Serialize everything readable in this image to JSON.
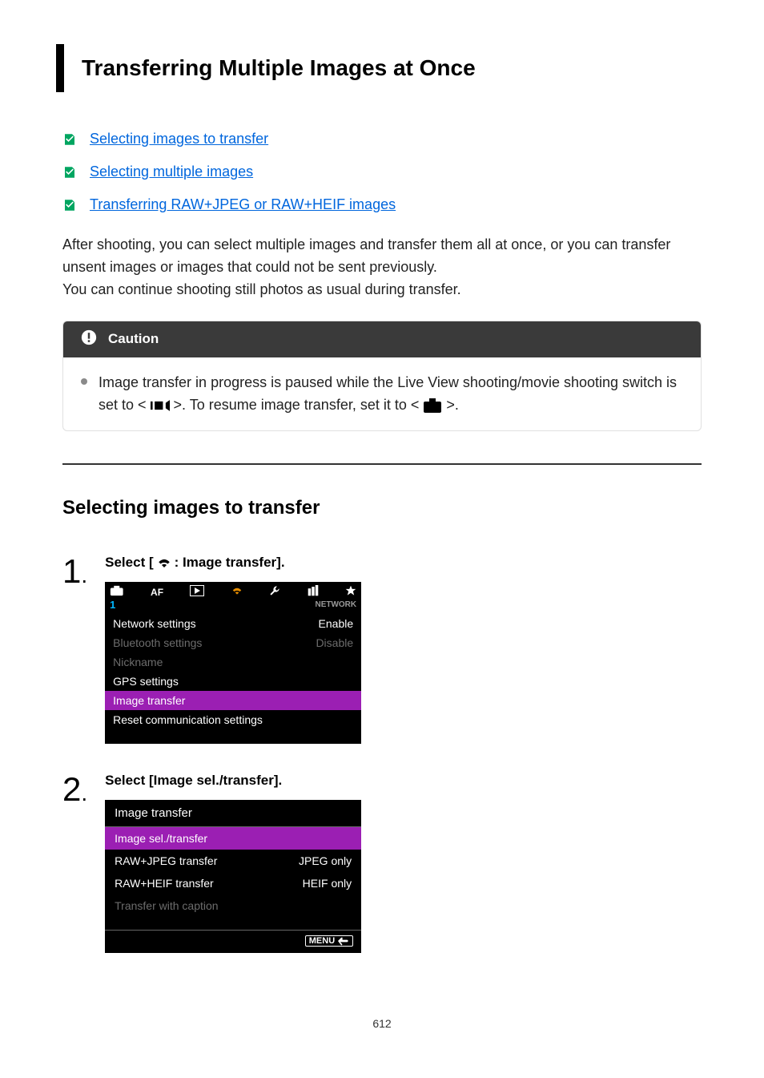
{
  "title": "Transferring Multiple Images at Once",
  "toc_links": [
    {
      "label": "Selecting images to transfer"
    },
    {
      "label": "Selecting multiple images"
    },
    {
      "label": "Transferring RAW+JPEG or RAW+HEIF images"
    }
  ],
  "intro_paragraph": "After shooting, you can select multiple images and transfer them all at once, or you can transfer unsent images or images that could not be sent previously.\nYou can continue shooting still photos as usual during transfer.",
  "caution": {
    "heading": "Caution",
    "text_before": "Image transfer in progress is paused while the Live View shooting/movie shooting switch is set to < ",
    "text_middle": " >. To resume image transfer, set it to < ",
    "text_after": " >."
  },
  "section_heading": "Selecting images to transfer",
  "steps": {
    "s1": {
      "number": "1",
      "label_before": "Select [",
      "label_after": ": Image transfer].",
      "lcd": {
        "page_indicator": "1",
        "network_tag": "NETWORK",
        "rows": [
          {
            "label": "Network settings",
            "value": "Enable",
            "state": "normal"
          },
          {
            "label": "Bluetooth settings",
            "value": "Disable",
            "state": "disabled"
          },
          {
            "label": "Nickname",
            "value": "",
            "state": "disabled"
          },
          {
            "label": "GPS settings",
            "value": "",
            "state": "normal"
          },
          {
            "label": "Image transfer",
            "value": "",
            "state": "sel"
          },
          {
            "label": "Reset communication settings",
            "value": "",
            "state": "normal"
          }
        ]
      }
    },
    "s2": {
      "number": "2",
      "label": "Select [Image sel./transfer].",
      "lcd": {
        "header": "Image transfer",
        "rows": [
          {
            "label": "Image sel./transfer",
            "value": "",
            "state": "sel"
          },
          {
            "label": "RAW+JPEG transfer",
            "value": "JPEG only",
            "state": "normal"
          },
          {
            "label": "RAW+HEIF transfer",
            "value": "HEIF only",
            "state": "normal"
          },
          {
            "label": "Transfer with caption",
            "value": "",
            "state": "disabled"
          }
        ],
        "menu_label": "MENU"
      }
    }
  },
  "page_number": "612"
}
